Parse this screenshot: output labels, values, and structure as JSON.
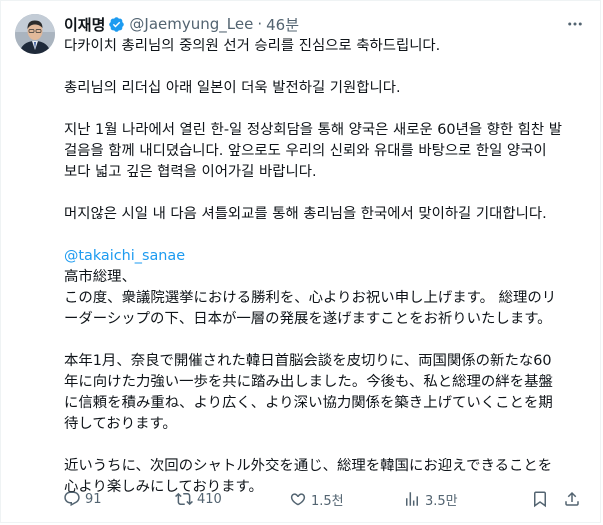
{
  "tweet": {
    "author_name": "이재명",
    "author_handle": "@Jaemyung_Lee",
    "separator": "·",
    "timestamp": "46분",
    "paragraphs": [
      "다카이치 총리님의 중의원 선거 승리를 진심으로 축하드립니다.",
      "총리님의 리더십 아래 일본이 더욱 발전하길 기원합니다.",
      "지난 1월 나라에서 열린 한-일 정상회담을 통해 양국은 새로운 60년을 향한 힘찬 발걸음을 함께 내디뎠습니다. 앞으로도 우리의 신뢰와 유대를 바탕으로 한일 양국이 보다 넓고 깊은 협력을 이어가길 바랍니다.",
      "머지않은 시일 내 다음 셔틀외교를 통해 총리님을 한국에서 맞이하길 기대합니다."
    ],
    "mention": "@takaichi_sanae",
    "jp_greeting": "高市総理、",
    "jp_paragraphs": [
      "この度、衆議院選挙における勝利を、心よりお祝い申し上げます。 総理のリーダーシップの下、日本が一層の発展を遂げますことをお祈りいたします。",
      "本年1月、奈良で開催された韓日首脳会談を皮切りに、両国関係の新たな60年に向けた力強い一歩を共に踏み出しました。今後も、私と総理の絆を基盤に信頼を積み重ね、より広く、より深い協力関係を築き上げていくことを期待しております。",
      "近いうちに、次回のシャトル外交を通じ、総理を韓国にお迎えできることを心より楽しみにしております。"
    ]
  },
  "actions": {
    "replies": "91",
    "reposts": "410",
    "likes": "1.5천",
    "views": "3.5만"
  },
  "icons": {
    "verified": "verified-badge-icon",
    "more": "more-dots-icon",
    "reply": "reply-icon",
    "repost": "repost-icon",
    "like": "heart-icon",
    "views": "views-chart-icon",
    "bookmark": "bookmark-icon",
    "share": "share-icon"
  },
  "colors": {
    "accent": "#1d9bf0",
    "text": "#0f1419",
    "muted": "#536471"
  }
}
